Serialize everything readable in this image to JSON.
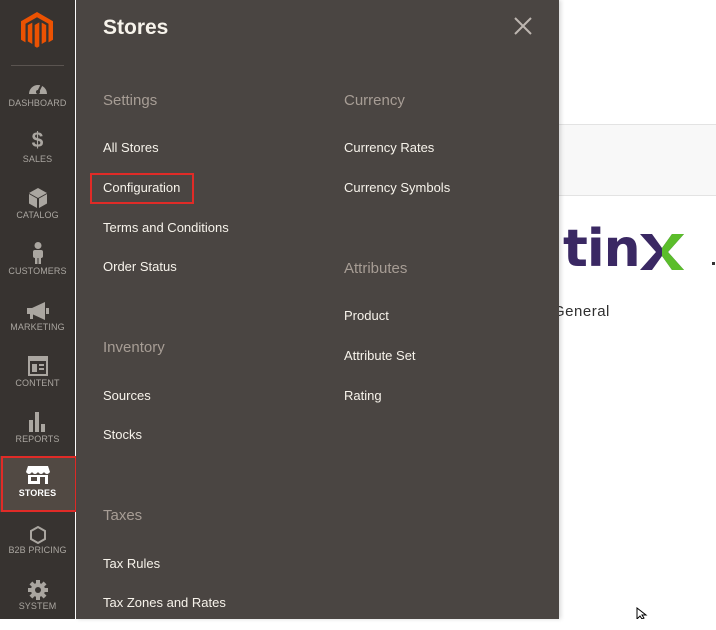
{
  "sidebar": {
    "items": [
      {
        "key": "dashboard",
        "label": "DASHBOARD",
        "icon": "dashboard-icon"
      },
      {
        "key": "sales",
        "label": "SALES",
        "icon": "dollar-icon"
      },
      {
        "key": "catalog",
        "label": "CATALOG",
        "icon": "box-icon"
      },
      {
        "key": "customers",
        "label": "CUSTOMERS",
        "icon": "person-icon"
      },
      {
        "key": "marketing",
        "label": "MARKETING",
        "icon": "megaphone-icon"
      },
      {
        "key": "content",
        "label": "CONTENT",
        "icon": "layout-icon"
      },
      {
        "key": "reports",
        "label": "REPORTS",
        "icon": "bar-chart-icon"
      },
      {
        "key": "stores",
        "label": "STORES",
        "icon": "storefront-icon",
        "active": true
      },
      {
        "key": "b2b_pricing",
        "label": "B2B PRICING",
        "icon": "hexagon-icon"
      },
      {
        "key": "system",
        "label": "SYSTEM",
        "icon": "gear-icon"
      }
    ]
  },
  "flyout": {
    "title": "Stores",
    "close_icon": "close-icon",
    "sections": {
      "settings": {
        "heading": "Settings",
        "links": [
          "All Stores",
          "Configuration",
          "Terms and Conditions",
          "Order Status"
        ]
      },
      "inventory": {
        "heading": "Inventory",
        "links": [
          "Sources",
          "Stocks"
        ]
      },
      "taxes": {
        "heading": "Taxes",
        "links": [
          "Tax Rules",
          "Tax Zones and Rates"
        ]
      },
      "currency": {
        "heading": "Currency",
        "links": [
          "Currency Rates",
          "Currency Symbols"
        ]
      },
      "attributes": {
        "heading": "Attributes",
        "links": [
          "Product",
          "Attribute Set",
          "Rating"
        ]
      }
    }
  },
  "background": {
    "logo_text": "tinx",
    "general_text": "General"
  },
  "colors": {
    "sidebar_bg": "#373330",
    "flyout_bg": "#4a4542",
    "accent_orange": "#eb5202",
    "highlight_red": "#e02b27",
    "logo_purple": "#3a2863",
    "logo_green": "#5bbd2b"
  }
}
